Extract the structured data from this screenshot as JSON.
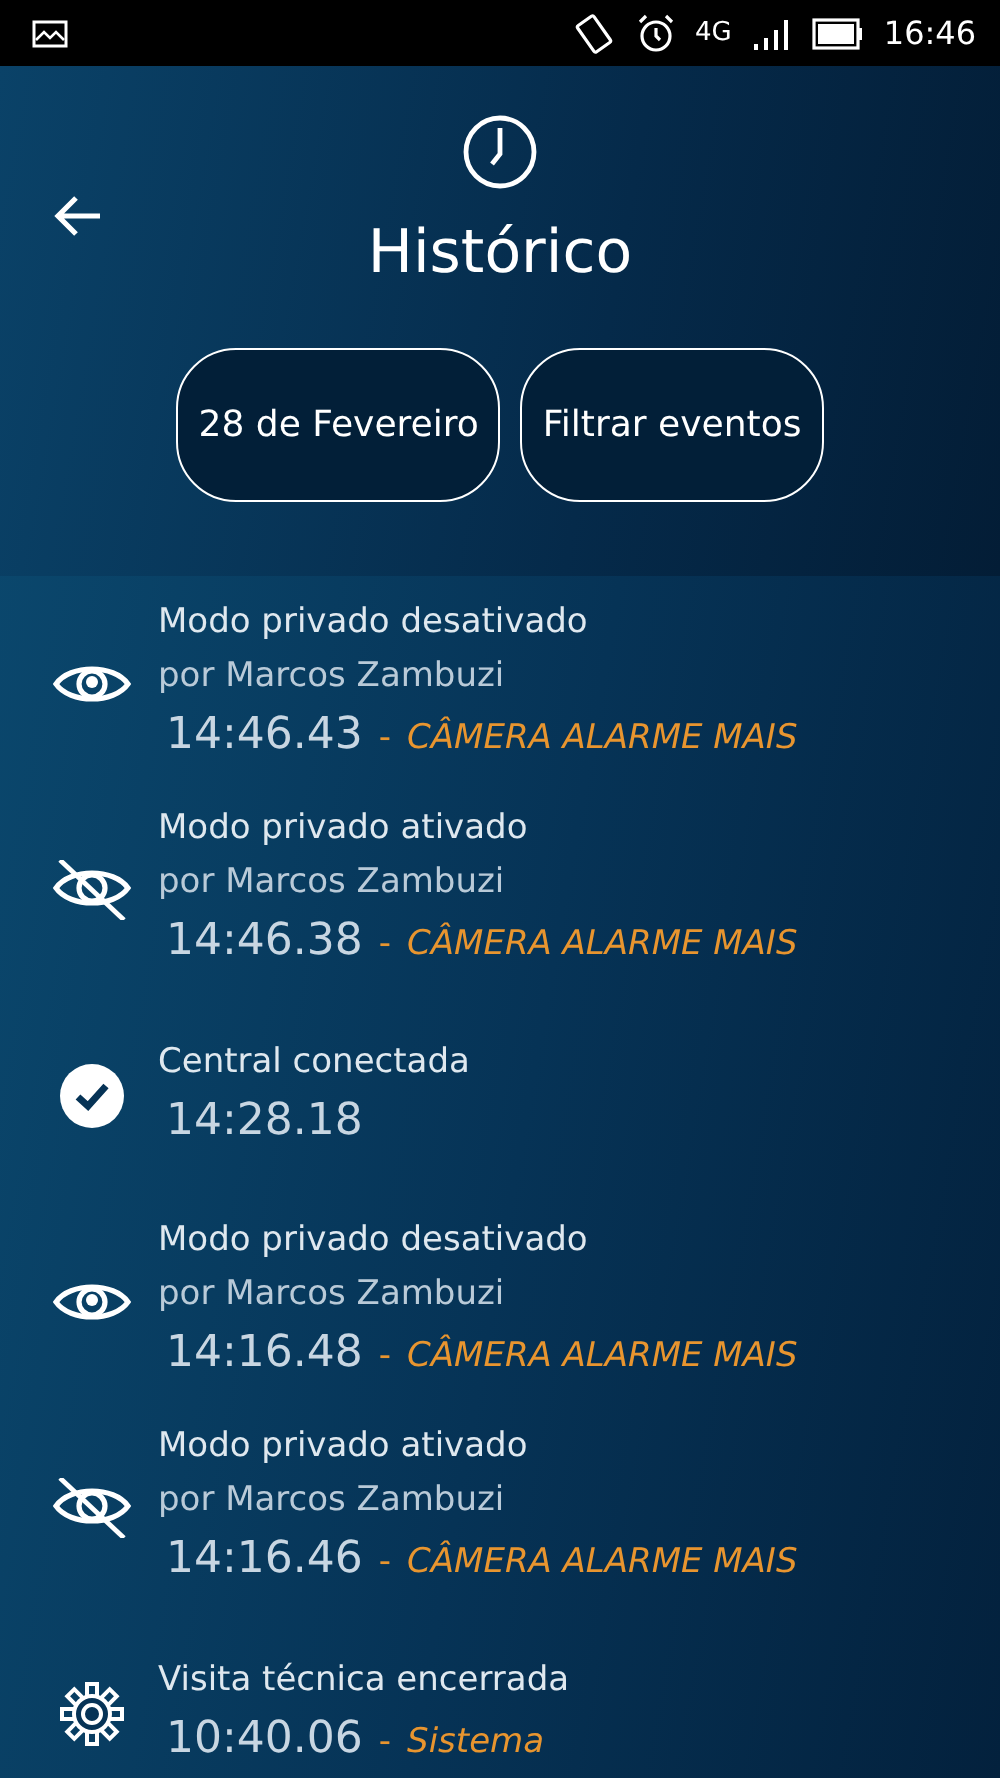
{
  "status_bar": {
    "time": "16:46",
    "network": "4G"
  },
  "header": {
    "title": "Histórico",
    "buttons": [
      "28 de Fevereiro",
      "Filtrar eventos"
    ]
  },
  "events": [
    {
      "kind": "eye",
      "title": "Modo privado desativado",
      "by": "por Marcos Zambuzi",
      "time": "14:46.43",
      "separator": "-",
      "source": "CÂMERA ALARME MAIS"
    },
    {
      "kind": "eye-off",
      "title": "Modo privado ativado",
      "by": "por Marcos Zambuzi",
      "time": "14:46.38",
      "separator": "-",
      "source": "CÂMERA ALARME MAIS"
    },
    {
      "kind": "check",
      "title": "Central conectada",
      "time": "14:28.18"
    },
    {
      "kind": "eye",
      "title": "Modo privado desativado",
      "by": "por Marcos Zambuzi",
      "time": "14:16.48",
      "separator": "-",
      "source": "CÂMERA ALARME MAIS"
    },
    {
      "kind": "eye-off",
      "title": "Modo privado ativado",
      "by": "por Marcos Zambuzi",
      "time": "14:16.46",
      "separator": "-",
      "source": "CÂMERA ALARME MAIS"
    },
    {
      "kind": "gear",
      "title": "Visita técnica encerrada",
      "time": "10:40.06",
      "separator": "-",
      "source": "Sistema"
    }
  ]
}
